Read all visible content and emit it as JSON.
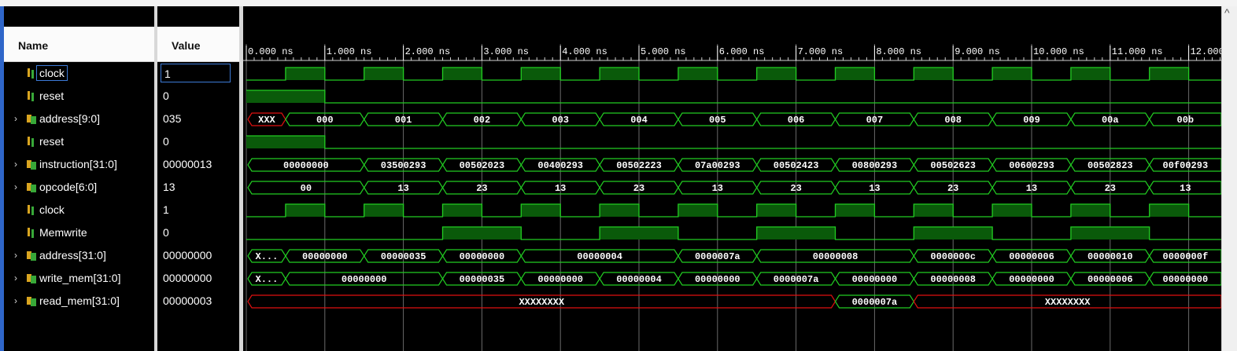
{
  "header": {
    "name_label": "Name",
    "value_label": "Value"
  },
  "timeline": {
    "ticks": [
      "0.000 ns",
      "1.000 ns",
      "2.000 ns",
      "3.000 ns",
      "4.000 ns",
      "5.000 ns",
      "6.000 ns",
      "7.000 ns",
      "8.000 ns",
      "9.000 ns",
      "10.000 ns",
      "11.000 ns",
      "12.000 ns"
    ]
  },
  "colors": {
    "wave": "#22cc22",
    "fill": "#0a5a0a",
    "unknown": "#e01010",
    "text": "#ffffff"
  },
  "signals": [
    {
      "name": "clock",
      "value": "1",
      "kind": "bit",
      "expandable": false,
      "selected": true,
      "trace": {
        "type": "clock",
        "first_high": 0.5,
        "half_period": 0.5
      }
    },
    {
      "name": "reset",
      "value": "0",
      "kind": "bit",
      "expandable": false,
      "trace": {
        "type": "steps",
        "steps": [
          [
            0,
            1
          ],
          [
            1,
            0
          ]
        ]
      }
    },
    {
      "name": "address[9:0]",
      "value": "035",
      "kind": "bus",
      "expandable": true,
      "trace": {
        "type": "bus",
        "segs": [
          [
            0,
            0.5,
            "XXX",
            1
          ],
          [
            0.5,
            1.5,
            "000"
          ],
          [
            1.5,
            2.5,
            "001"
          ],
          [
            2.5,
            3.5,
            "002"
          ],
          [
            3.5,
            4.5,
            "003"
          ],
          [
            4.5,
            5.5,
            "004"
          ],
          [
            5.5,
            6.5,
            "005"
          ],
          [
            6.5,
            7.5,
            "006"
          ],
          [
            7.5,
            8.5,
            "007"
          ],
          [
            8.5,
            9.5,
            "008"
          ],
          [
            9.5,
            10.5,
            "009"
          ],
          [
            10.5,
            11.5,
            "00a"
          ],
          [
            11.5,
            12.5,
            "00b"
          ]
        ]
      }
    },
    {
      "name": "reset",
      "value": "0",
      "kind": "bit",
      "expandable": false,
      "trace": {
        "type": "steps",
        "steps": [
          [
            0,
            1
          ],
          [
            1,
            0
          ]
        ]
      }
    },
    {
      "name": "instruction[31:0]",
      "value": "00000013",
      "kind": "bus",
      "expandable": true,
      "trace": {
        "type": "bus",
        "segs": [
          [
            0,
            1.5,
            "00000000"
          ],
          [
            1.5,
            2.5,
            "03500293"
          ],
          [
            2.5,
            3.5,
            "00502023"
          ],
          [
            3.5,
            4.5,
            "00400293"
          ],
          [
            4.5,
            5.5,
            "00502223"
          ],
          [
            5.5,
            6.5,
            "07a00293"
          ],
          [
            6.5,
            7.5,
            "00502423"
          ],
          [
            7.5,
            8.5,
            "00800293"
          ],
          [
            8.5,
            9.5,
            "00502623"
          ],
          [
            9.5,
            10.5,
            "00600293"
          ],
          [
            10.5,
            11.5,
            "00502823"
          ],
          [
            11.5,
            12.5,
            "00f00293"
          ]
        ]
      }
    },
    {
      "name": "opcode[6:0]",
      "value": "13",
      "kind": "bus",
      "expandable": true,
      "trace": {
        "type": "bus",
        "segs": [
          [
            0,
            1.5,
            "00"
          ],
          [
            1.5,
            2.5,
            "13"
          ],
          [
            2.5,
            3.5,
            "23"
          ],
          [
            3.5,
            4.5,
            "13"
          ],
          [
            4.5,
            5.5,
            "23"
          ],
          [
            5.5,
            6.5,
            "13"
          ],
          [
            6.5,
            7.5,
            "23"
          ],
          [
            7.5,
            8.5,
            "13"
          ],
          [
            8.5,
            9.5,
            "23"
          ],
          [
            9.5,
            10.5,
            "13"
          ],
          [
            10.5,
            11.5,
            "23"
          ],
          [
            11.5,
            12.5,
            "13"
          ]
        ]
      }
    },
    {
      "name": "clock",
      "value": "1",
      "kind": "bit",
      "expandable": false,
      "trace": {
        "type": "clock",
        "first_high": 0.5,
        "half_period": 0.5
      }
    },
    {
      "name": "Memwrite",
      "value": "0",
      "kind": "bit",
      "expandable": false,
      "trace": {
        "type": "steps",
        "steps": [
          [
            0,
            0
          ],
          [
            2.5,
            1
          ],
          [
            3.5,
            0
          ],
          [
            4.5,
            1
          ],
          [
            5.5,
            0
          ],
          [
            6.5,
            1
          ],
          [
            7.5,
            0
          ],
          [
            8.5,
            1
          ],
          [
            9.5,
            0
          ],
          [
            10.5,
            1
          ],
          [
            11.5,
            0
          ]
        ]
      }
    },
    {
      "name": "address[31:0]",
      "value": "00000000",
      "kind": "bus",
      "expandable": true,
      "trace": {
        "type": "bus",
        "segs": [
          [
            0,
            0.5,
            "X...",
            0
          ],
          [
            0.5,
            1.5,
            "00000000"
          ],
          [
            1.5,
            2.5,
            "00000035"
          ],
          [
            2.5,
            3.5,
            "00000000"
          ],
          [
            3.5,
            5.5,
            "00000004"
          ],
          [
            5.5,
            6.5,
            "0000007a"
          ],
          [
            6.5,
            8.5,
            "00000008"
          ],
          [
            8.5,
            9.5,
            "0000000c"
          ],
          [
            9.5,
            10.5,
            "00000006"
          ],
          [
            10.5,
            11.5,
            "00000010"
          ],
          [
            11.5,
            12.5,
            "0000000f"
          ]
        ]
      }
    },
    {
      "name": "write_mem[31:0]",
      "value": "00000000",
      "kind": "bus",
      "expandable": true,
      "trace": {
        "type": "bus",
        "segs": [
          [
            0,
            0.5,
            "X...",
            0
          ],
          [
            0.5,
            2.5,
            "00000000"
          ],
          [
            2.5,
            3.5,
            "00000035"
          ],
          [
            3.5,
            4.5,
            "00000000"
          ],
          [
            4.5,
            5.5,
            "00000004"
          ],
          [
            5.5,
            6.5,
            "00000000"
          ],
          [
            6.5,
            7.5,
            "0000007a"
          ],
          [
            7.5,
            8.5,
            "00000000"
          ],
          [
            8.5,
            9.5,
            "00000008"
          ],
          [
            9.5,
            10.5,
            "00000000"
          ],
          [
            10.5,
            11.5,
            "00000006"
          ],
          [
            11.5,
            12.5,
            "00000000"
          ]
        ]
      }
    },
    {
      "name": "read_mem[31:0]",
      "value": "00000003",
      "kind": "bus",
      "expandable": true,
      "trace": {
        "type": "bus",
        "segs": [
          [
            0,
            7.5,
            "XXXXXXXX",
            1
          ],
          [
            7.5,
            8.5,
            "0000007a"
          ],
          [
            8.5,
            12.5,
            "XXXXXXXX",
            1
          ]
        ]
      }
    }
  ]
}
